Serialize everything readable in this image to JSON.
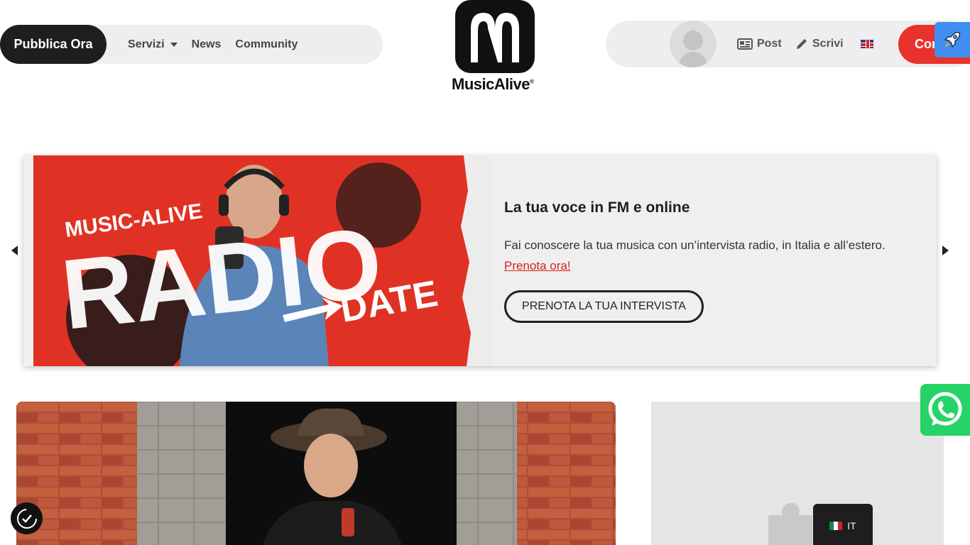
{
  "nav_left": {
    "publish_label": "Pubblica Ora",
    "items": [
      {
        "label": "Servizi",
        "has_dropdown": true
      },
      {
        "label": "News"
      },
      {
        "label": "Community"
      }
    ]
  },
  "logo": {
    "text": "MusicAlive",
    "reg": "®"
  },
  "nav_right": {
    "post_label": "Post",
    "write_label": "Scrivi",
    "language_flag": "uk-flag",
    "contact_label": "Con"
  },
  "banner": {
    "title": "La tua voce in FM e online",
    "description": "Fai conoscere la tua musica con un’intervista radio, in Italia e all’estero.",
    "link_label": "Prenota ora!",
    "cta_label": "PRENOTA LA TUA INTERVISTA",
    "image_text": {
      "brand": "MUSIC-ALIVE",
      "big": "RADIO",
      "sub": "DATE"
    }
  },
  "language_switcher": {
    "code": "IT"
  },
  "colors": {
    "accent_red": "#e8322b",
    "dark": "#1e1e1e",
    "whatsapp_green": "#25d366",
    "rocket_blue": "#3f8ef0"
  }
}
